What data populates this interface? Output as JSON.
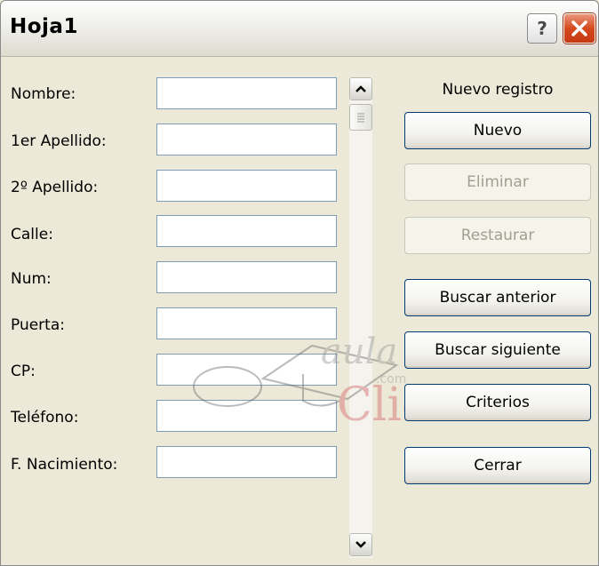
{
  "window": {
    "title": "Hoja1",
    "help_label": "?",
    "close_color": "#d64a1e"
  },
  "form": {
    "fields": [
      {
        "label": "Nombre:",
        "value": ""
      },
      {
        "label": "1er Apellido:",
        "value": ""
      },
      {
        "label": "2º Apellido:",
        "value": ""
      },
      {
        "label": "Calle:",
        "value": ""
      },
      {
        "label": "Num:",
        "value": ""
      },
      {
        "label": "Puerta:",
        "value": ""
      },
      {
        "label": "CP:",
        "value": ""
      },
      {
        "label": "Teléfono:",
        "value": ""
      },
      {
        "label": "F. Nacimiento:",
        "value": ""
      }
    ]
  },
  "record_status": "Nuevo registro",
  "buttons": {
    "nuevo": "Nuevo",
    "eliminar": "Eliminar",
    "restaurar": "Restaurar",
    "buscar_anterior": "Buscar anterior",
    "buscar_siguiente": "Buscar siguiente",
    "criterios": "Criterios",
    "cerrar": "Cerrar"
  },
  "watermark": {
    "brand_top": "aula",
    "brand_dot": ".com",
    "brand_bottom": "Clic"
  }
}
